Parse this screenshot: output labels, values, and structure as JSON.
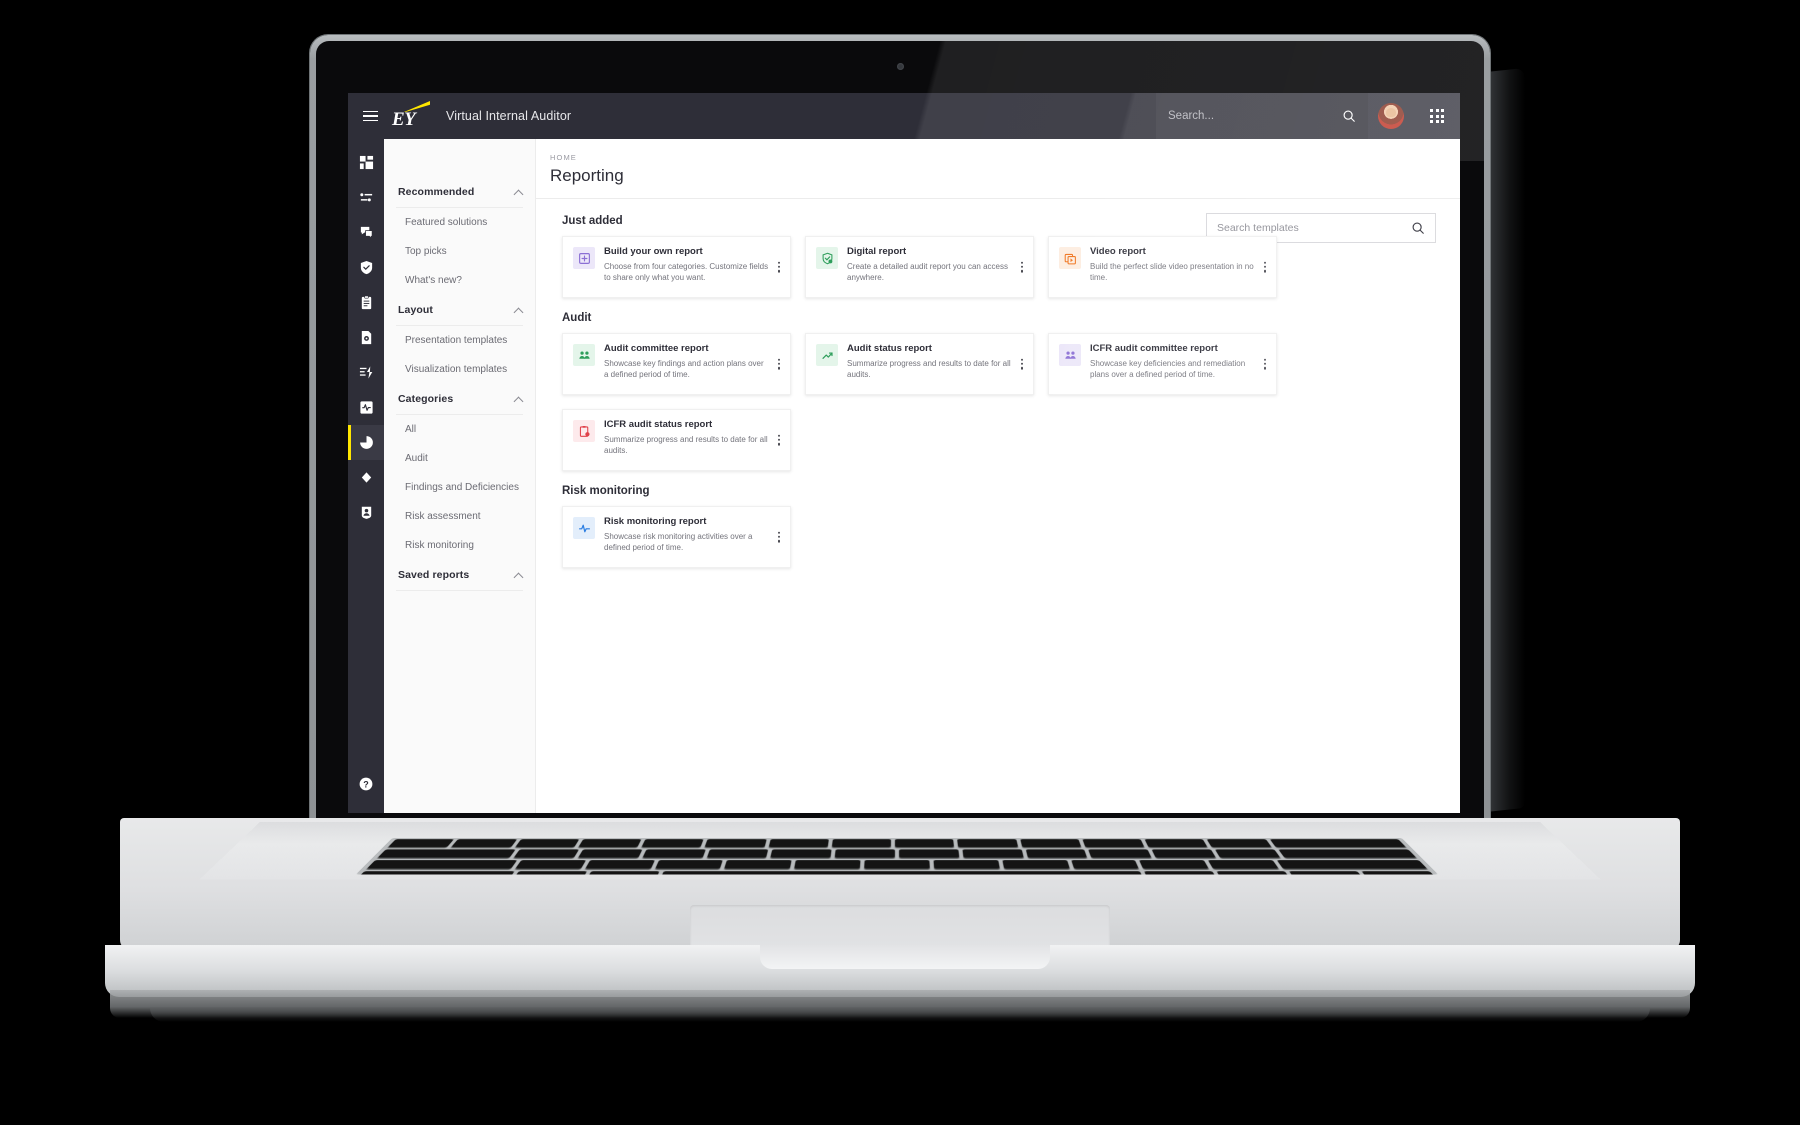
{
  "topbar": {
    "menu_icon": "hamburger-icon",
    "logo_text": "EY",
    "app_title": "Virtual Internal Auditor",
    "search_placeholder": "Search...",
    "search_value": "",
    "search_icon": "search-icon",
    "avatar_icon": "user-avatar",
    "apps_icon": "app-grid-icon"
  },
  "rail": {
    "items": [
      {
        "icon": "dashboard-icon",
        "active": false
      },
      {
        "icon": "list-bullets-icon",
        "active": false
      },
      {
        "icon": "chat-bubbles-icon",
        "active": false
      },
      {
        "icon": "shield-check-icon",
        "active": false
      },
      {
        "icon": "clipboard-icon",
        "active": false
      },
      {
        "icon": "document-gear-icon",
        "active": false
      },
      {
        "icon": "lightning-bolt-icon",
        "active": false
      },
      {
        "icon": "pulse-square-icon",
        "active": false
      },
      {
        "icon": "pie-chart-icon",
        "active": true
      },
      {
        "icon": "diamond-icon",
        "active": false
      },
      {
        "icon": "user-badge-icon",
        "active": false
      }
    ],
    "help_icon": "help-circle-icon"
  },
  "breadcrumb": "HOME",
  "page_title": "Reporting",
  "panel": {
    "groups": [
      {
        "title": "Recommended",
        "caret": "chevron-up-icon",
        "items": [
          "Featured solutions",
          "Top picks",
          "What's new?"
        ]
      },
      {
        "title": "Layout",
        "caret": "chevron-up-icon",
        "items": [
          "Presentation templates",
          "Visualization templates"
        ]
      },
      {
        "title": "Categories",
        "caret": "chevron-up-icon",
        "items": [
          "All",
          "Audit",
          "Findings and Deficiencies",
          "Risk assessment",
          "Risk monitoring"
        ]
      },
      {
        "title": "Saved reports",
        "caret": "chevron-up-icon",
        "items": []
      }
    ]
  },
  "template_search": {
    "placeholder": "Search templates",
    "value": "",
    "icon": "search-icon"
  },
  "sections": [
    {
      "title": "Just added",
      "cards": [
        {
          "title": "Build your own report",
          "desc": "Choose from four categories. Customize fields to share only what you want.",
          "icon": "plus-square-icon",
          "icon_color": "#8b6fd4",
          "icon_bg": "#ece7f9",
          "menu_icon": "kebab-menu-icon"
        },
        {
          "title": "Digital report",
          "desc": "Create a detailed audit report you can access anywhere.",
          "icon": "check-shield-icon",
          "icon_color": "#2e9e5b",
          "icon_bg": "#e4f5ea",
          "menu_icon": "kebab-menu-icon"
        },
        {
          "title": "Video report",
          "desc": "Build the perfect slide video presentation in no time.",
          "icon": "video-play-icon",
          "icon_color": "#f07b2a",
          "icon_bg": "#fdeee2",
          "menu_icon": "kebab-menu-icon"
        }
      ]
    },
    {
      "title": "Audit",
      "cards": [
        {
          "title": "Audit committee report",
          "desc": "Showcase key findings and action plans over a defined period of time.",
          "icon": "people-group-icon",
          "icon_color": "#2e9e5b",
          "icon_bg": "#e4f5ea",
          "menu_icon": "kebab-menu-icon"
        },
        {
          "title": "Audit status report",
          "desc": "Summarize progress and results to date for all audits.",
          "icon": "trend-arrow-icon",
          "icon_color": "#2e9e5b",
          "icon_bg": "#e4f5ea",
          "menu_icon": "kebab-menu-icon"
        },
        {
          "title": "ICFR audit committee report",
          "desc": "Showcase key deficiencies and remediation plans over a defined period of time.",
          "icon": "people-group-icon",
          "icon_color": "#8b6fd4",
          "icon_bg": "#ece7f9",
          "menu_icon": "kebab-menu-icon"
        },
        {
          "title": "ICFR audit status report",
          "desc": "Summarize progress and results to date for all audits.",
          "icon": "clipboard-alert-icon",
          "icon_color": "#e0414a",
          "icon_bg": "#fdeaec",
          "menu_icon": "kebab-menu-icon"
        }
      ]
    },
    {
      "title": "Risk monitoring",
      "cards": [
        {
          "title": "Risk monitoring report",
          "desc": "Showcase risk monitoring activities over a defined period of time.",
          "icon": "pulse-icon",
          "icon_color": "#2a7de1",
          "icon_bg": "#e3eefb",
          "menu_icon": "kebab-menu-icon"
        }
      ]
    }
  ],
  "colors": {
    "brand_yellow": "#ffe600",
    "chrome_dark": "#2e2e38",
    "panel_bg": "#fafafa"
  }
}
